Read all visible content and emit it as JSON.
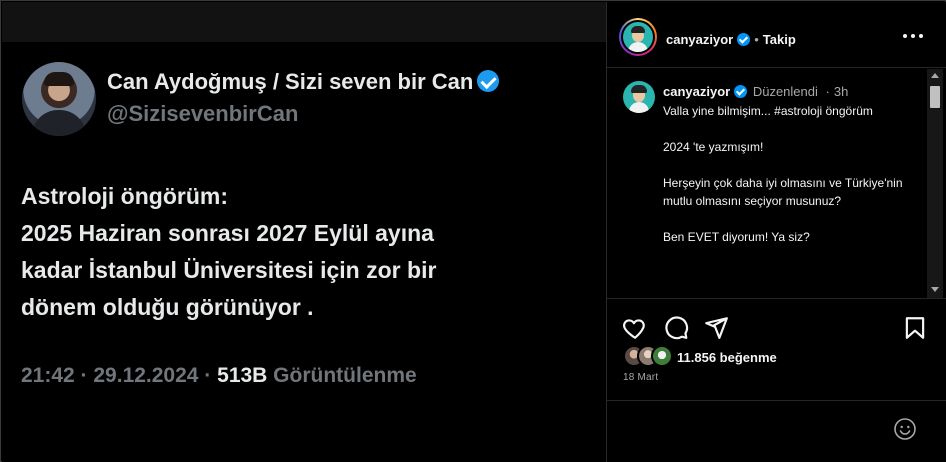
{
  "tweet": {
    "display_name": "Can Aydoğmuş / Sizi seven bir Can",
    "handle": "@SizisevenbirCan",
    "lines": [
      "Astroloji öngörüm:",
      "2025 Haziran sonrası 2027 Eylül ayına",
      "kadar İstanbul Üniversitesi için zor bir",
      "dönem olduğu görünüyor ."
    ],
    "timestamp": "21:42 · 29.12.2024 · ",
    "views": "513B",
    "views_label": " Görüntülenme"
  },
  "instagram": {
    "header": {
      "username": "canyaziyor",
      "separator": "•",
      "follow_label": "Takip"
    },
    "caption": {
      "username": "canyaziyor",
      "edited": "Düzenlendi",
      "separator": "·",
      "time": "3h",
      "paragraphs": [
        "Valla yine bilmişim... #astroloji öngörüm",
        "2024 'te yazmışım!",
        "Herşeyin çok daha iyi olmasını ve Türkiye'nin mutlu olmasını seçiyor musunuz?",
        "Ben EVET diyorum! Ya siz?"
      ]
    },
    "likes": "11.856 beğenme",
    "date": "18 Mart",
    "icons": [
      "more-icon",
      "heart-icon",
      "comment-icon",
      "share-icon",
      "save-icon",
      "emoji-icon"
    ],
    "colors": {
      "verified": "#0095f6",
      "avatar_bg": "#2ab5b0"
    }
  },
  "colors": {
    "x_verified": "#1d9bf0",
    "muted": "#71767b"
  }
}
